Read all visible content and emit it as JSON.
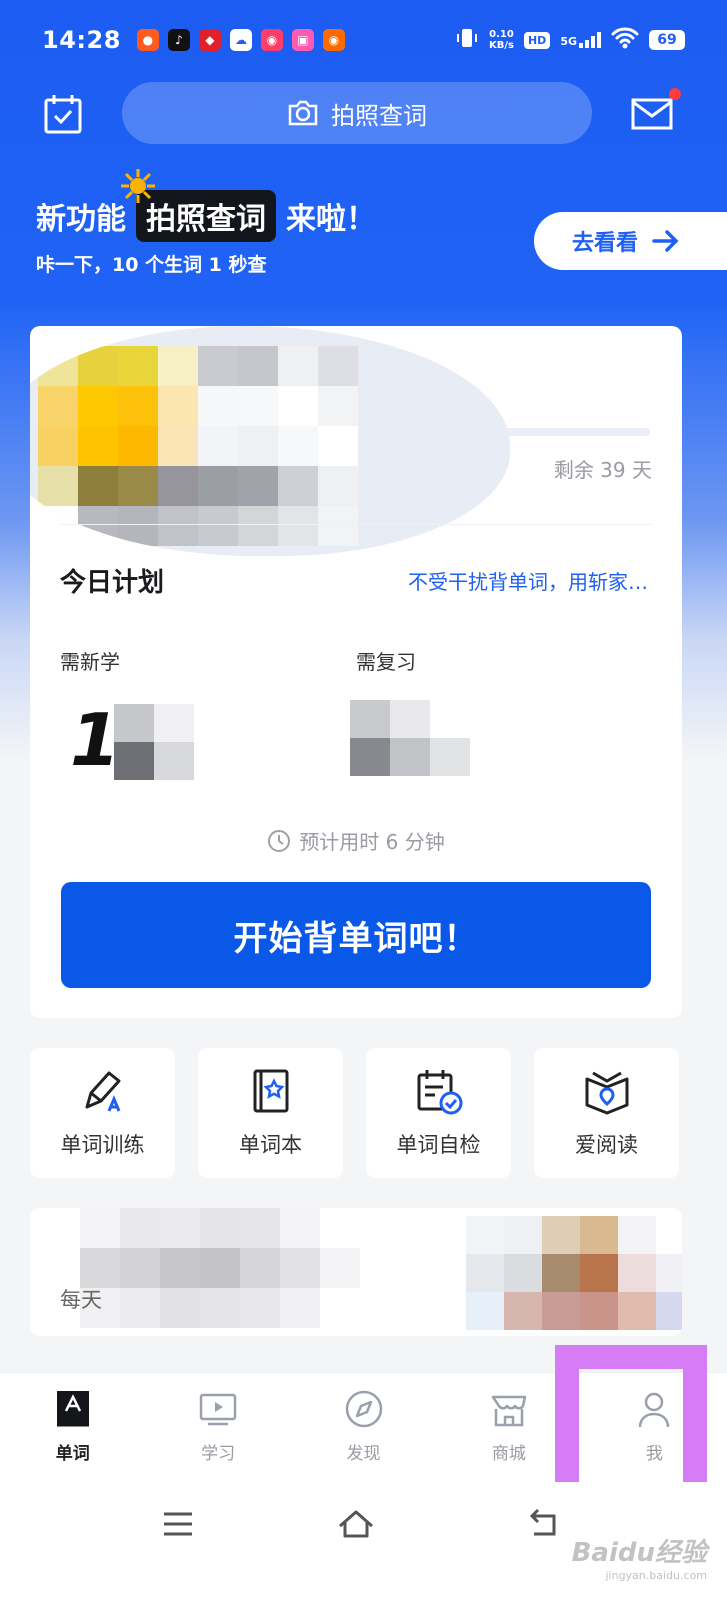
{
  "status_bar": {
    "time": "14:28",
    "net_speed_value": "0.10",
    "net_speed_unit": "KB/s",
    "hd": "HD",
    "network": "5G",
    "battery": "69"
  },
  "header": {
    "search_label": "拍照查词"
  },
  "promo": {
    "prefix": "新功能",
    "highlight": "拍照查词",
    "suffix": "来啦！",
    "subtitle": "咔一下，10 个生词 1 秒查",
    "button_label": "去看看"
  },
  "plan": {
    "remaining": "剩余 39 天",
    "title": "今日计划",
    "ad_link": "不受干扰背单词，用斩家…",
    "new_label": "需新学",
    "new_value_visible": "1",
    "review_label": "需复习",
    "estimate": "预计用时 6 分钟",
    "start_button": "开始背单词吧！"
  },
  "features": [
    {
      "label": "单词训练",
      "icon": "pencil-a-icon"
    },
    {
      "label": "单词本",
      "icon": "star-book-icon"
    },
    {
      "label": "单词自检",
      "icon": "calendar-check-icon"
    },
    {
      "label": "爱阅读",
      "icon": "open-book-icon"
    }
  ],
  "banner": {
    "daily_prefix": "每天"
  },
  "bottom_nav": [
    {
      "label": "单词",
      "icon": "letter-a-icon",
      "active": true
    },
    {
      "label": "学习",
      "icon": "play-screen-icon",
      "active": false
    },
    {
      "label": "发现",
      "icon": "compass-icon",
      "active": false
    },
    {
      "label": "商城",
      "icon": "store-icon",
      "active": false
    },
    {
      "label": "我",
      "icon": "person-icon",
      "active": false
    }
  ],
  "watermark": {
    "text": "Baidu经验",
    "url_text": "jingyan.baidu.com"
  },
  "colors": {
    "primary": "#1f5ff3",
    "button": "#0a58e8",
    "highlight_box": "#d67cf5"
  }
}
